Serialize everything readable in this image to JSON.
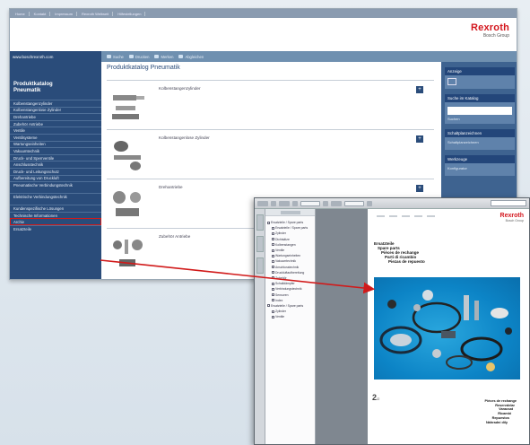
{
  "browser": {
    "top_nav": [
      "Home",
      "Kontakt",
      "Impressum",
      "Rexroth Weltweit",
      "Hilfestellungen"
    ],
    "logo": {
      "brand": "Rexroth",
      "group": "Bosch Group"
    },
    "site_url": "www.boschrexroth.com",
    "toolbar": [
      {
        "label": "Suche",
        "icon": "search-icon"
      },
      {
        "label": "Drucken",
        "icon": "print-icon"
      },
      {
        "label": "Merken",
        "icon": "bookmark-icon"
      },
      {
        "label": "Abgleichen",
        "icon": "compare-icon"
      }
    ],
    "sidebar": {
      "title_line1": "Produktkatalog",
      "title_line2": "Pneumatik",
      "items": [
        "Kolbenstangenzylinder",
        "Kolbenstangenlose Zylinder",
        "Drehantriebe",
        "Zubehör Antriebe",
        "Ventile",
        "Ventilsysteme",
        "Wartungseinheiten",
        "Vakuumtechnik",
        "Druck- und Sperrventile",
        "Anschlusstechnik",
        "Druck- und Leitungsschutz",
        "Aufbereitung von Druckluft",
        "Pneumatische Verbindungstechnik",
        "Elektrische Verbindungstechnik",
        "Kundenspezifische Lösungen",
        "Technische Informationen",
        "Archiv",
        "Ersatzteile"
      ],
      "highlighted_index": 16
    },
    "main": {
      "title": "Produktkatalog Pneumatik",
      "products": [
        "Kolbenstangenzylinder",
        "Kolbenstangenlose Zylinder",
        "Drehantriebe",
        "Zubehör Antriebe"
      ]
    },
    "right_panel": [
      {
        "title": "Anzeige",
        "body": ""
      },
      {
        "title": "Suche im Katalog",
        "body": "Suchen"
      },
      {
        "title": "Schaltplanzeichnen",
        "body": "Schaltplanzeichnen"
      },
      {
        "title": "Werkzeuge",
        "body": "Konfigurator"
      }
    ]
  },
  "pdf": {
    "logo": {
      "brand": "Rexroth",
      "group": "Bosch Group"
    },
    "bookmarks": [
      {
        "label": "Ersatzteile / Spare parts",
        "level": 0
      },
      {
        "label": "Ersatzteile / Spare parts",
        "level": 1
      },
      {
        "label": "Zylinder",
        "level": 1
      },
      {
        "label": "Dichtsätze",
        "level": 1
      },
      {
        "label": "Kolbenstangen",
        "level": 1
      },
      {
        "label": "Ventile",
        "level": 1
      },
      {
        "label": "Wartungseinheiten",
        "level": 1
      },
      {
        "label": "Vakuumtechnik",
        "level": 1
      },
      {
        "label": "Anschlusstechnik",
        "level": 1
      },
      {
        "label": "Druckluftaufbereitung",
        "level": 1
      },
      {
        "label": "Zubehör",
        "level": 1
      },
      {
        "label": "Schalldämpfer",
        "level": 1
      },
      {
        "label": "Verbindungstechnik",
        "level": 1
      },
      {
        "label": "Sensoren",
        "level": 1
      },
      {
        "label": "Index",
        "level": 1
      },
      {
        "label": "Ersatzteile / Spare parts",
        "level": 0
      },
      {
        "label": "Zylinder",
        "level": 1
      },
      {
        "label": "Ventile",
        "level": 1
      }
    ],
    "heading_langs": [
      "Ersatzteile",
      "Spare parts",
      "Pièces de rechange",
      "Parti di ricambio",
      "Piezas de repuesto"
    ],
    "page_number": "2",
    "page_number_suffix": "/2",
    "footer_langs": [
      "Pièces de rechange",
      "Reservdelar",
      "Varaosat",
      "Ricambi",
      "Repuestos",
      "Náhradní díly"
    ]
  }
}
